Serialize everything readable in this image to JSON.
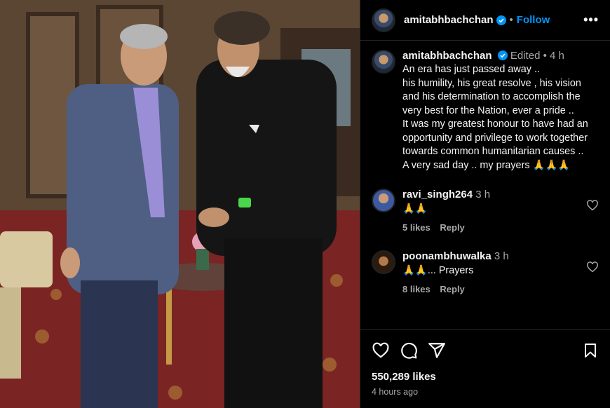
{
  "header": {
    "username": "amitabhbachchan",
    "follow_label": "Follow",
    "more_label": "•••"
  },
  "caption": {
    "username": "amitabhbachchan",
    "edited": "Edited",
    "time": "4 h",
    "text": "An era has just passed away ..\nhis humility, his great resolve , his vision and his determination to accomplish the very best for the Nation, ever a pride ..\nIt was my greatest honour to have had an opportunity and privilege to work together towards common humanitarian causes ..\nA very sad day .. my prayers 🙏🙏🙏"
  },
  "comments": [
    {
      "username": "ravi_singh264",
      "time": "3 h",
      "text": "🙏🙏",
      "likes": "5 likes",
      "reply": "Reply"
    },
    {
      "username": "poonambhuwalka",
      "time": "3 h",
      "text": "🙏🙏... Prayers",
      "likes": "8 likes",
      "reply": "Reply"
    }
  ],
  "footer": {
    "likes": "550,289 likes",
    "time": "4 hours ago"
  },
  "icons": [
    "heart-icon",
    "comment-icon",
    "share-icon",
    "bookmark-icon",
    "verified-badge-icon",
    "more-options-icon"
  ],
  "colors": {
    "accent": "#0095f6",
    "background": "#000000",
    "muted": "#a8a8a8"
  }
}
